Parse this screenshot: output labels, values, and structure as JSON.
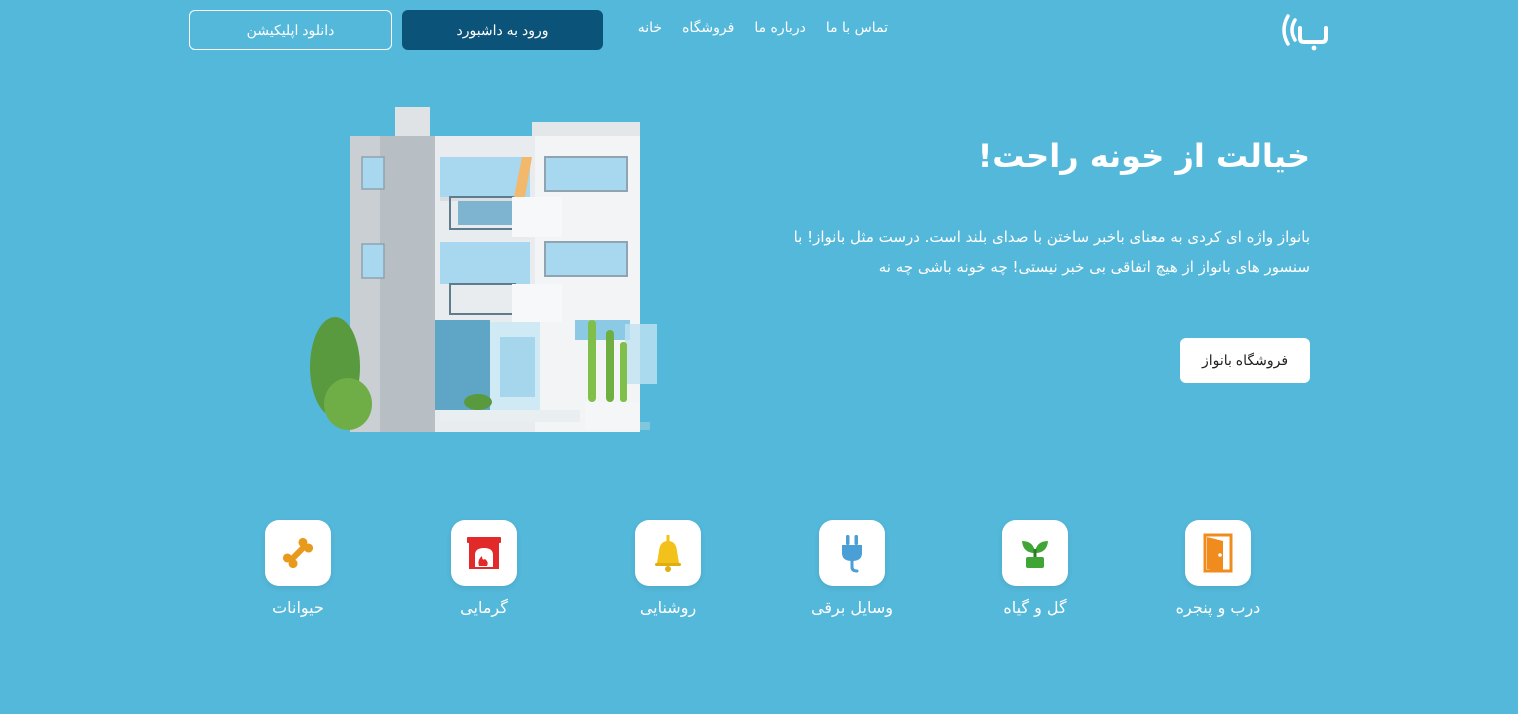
{
  "header": {
    "nav": [
      "خانه",
      "فروشگاه",
      "درباره ما",
      "تماس با ما"
    ],
    "dashboard_label": "ورود به داشبورد",
    "download_label": "دانلود اپلیکیشن"
  },
  "hero": {
    "title": "خیالت از خونه راحت!",
    "description": "بانواز واژه ای کردی به معنای باخبر ساختن با صدای بلند است. درست مثل بانواز! با سنسور های بانواز از هیچ اتفاقی بی خبر نیستی! چه خونه باشی چه نه",
    "shop_button": "فروشگاه بانواز"
  },
  "categories": [
    {
      "label": "درب و پنجره",
      "icon": "door-icon",
      "color": "#f08c1e"
    },
    {
      "label": "گل و گیاه",
      "icon": "plant-icon",
      "color": "#3fa535"
    },
    {
      "label": "وسایل برقی",
      "icon": "plug-icon",
      "color": "#4a9fd6"
    },
    {
      "label": "روشنایی",
      "icon": "bell-icon",
      "color": "#f2c21a"
    },
    {
      "label": "گرمایی",
      "icon": "fireplace-icon",
      "color": "#e32a2a"
    },
    {
      "label": "حیوانات",
      "icon": "bone-icon",
      "color": "#e89a1c"
    }
  ],
  "colors": {
    "background": "#54b8da",
    "dashboard_button": "#0c5379"
  }
}
